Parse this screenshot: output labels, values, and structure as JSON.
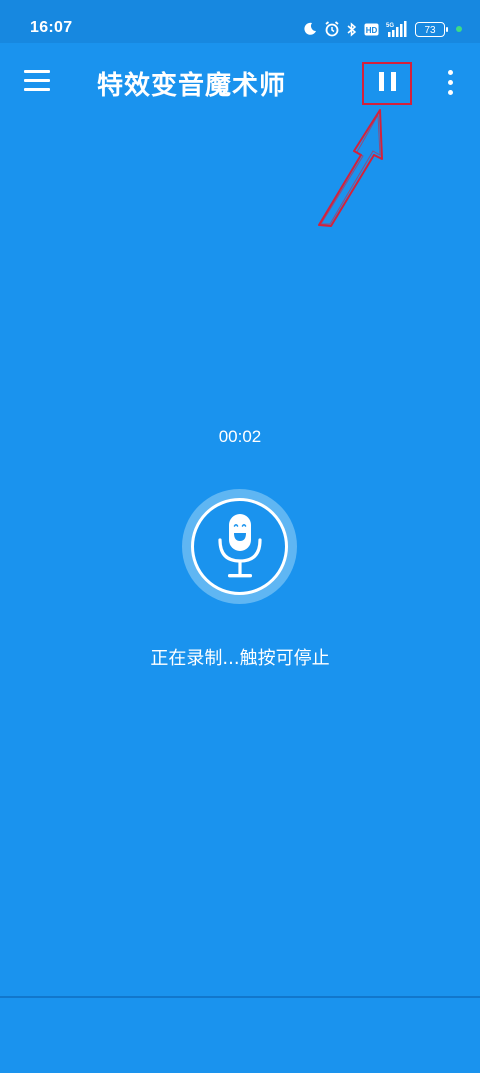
{
  "status_bar": {
    "time": "16:07",
    "battery": "73",
    "icons": [
      "moon-icon",
      "alarm-icon",
      "bluetooth-icon",
      "hd-icon",
      "signal-5g-icon"
    ]
  },
  "app_bar": {
    "title": "特效变音魔术师",
    "menu_icon": "hamburger-menu-icon",
    "pause_icon": "pause-icon",
    "more_icon": "more-vertical-icon"
  },
  "recording": {
    "timer": "00:02",
    "hint": "正在录制...触按可停止",
    "mic_icon": "smiling-microphone-icon"
  },
  "colors": {
    "background": "#1a93ee",
    "status_bar": "#1788e0",
    "annotation": "#d4213b"
  }
}
